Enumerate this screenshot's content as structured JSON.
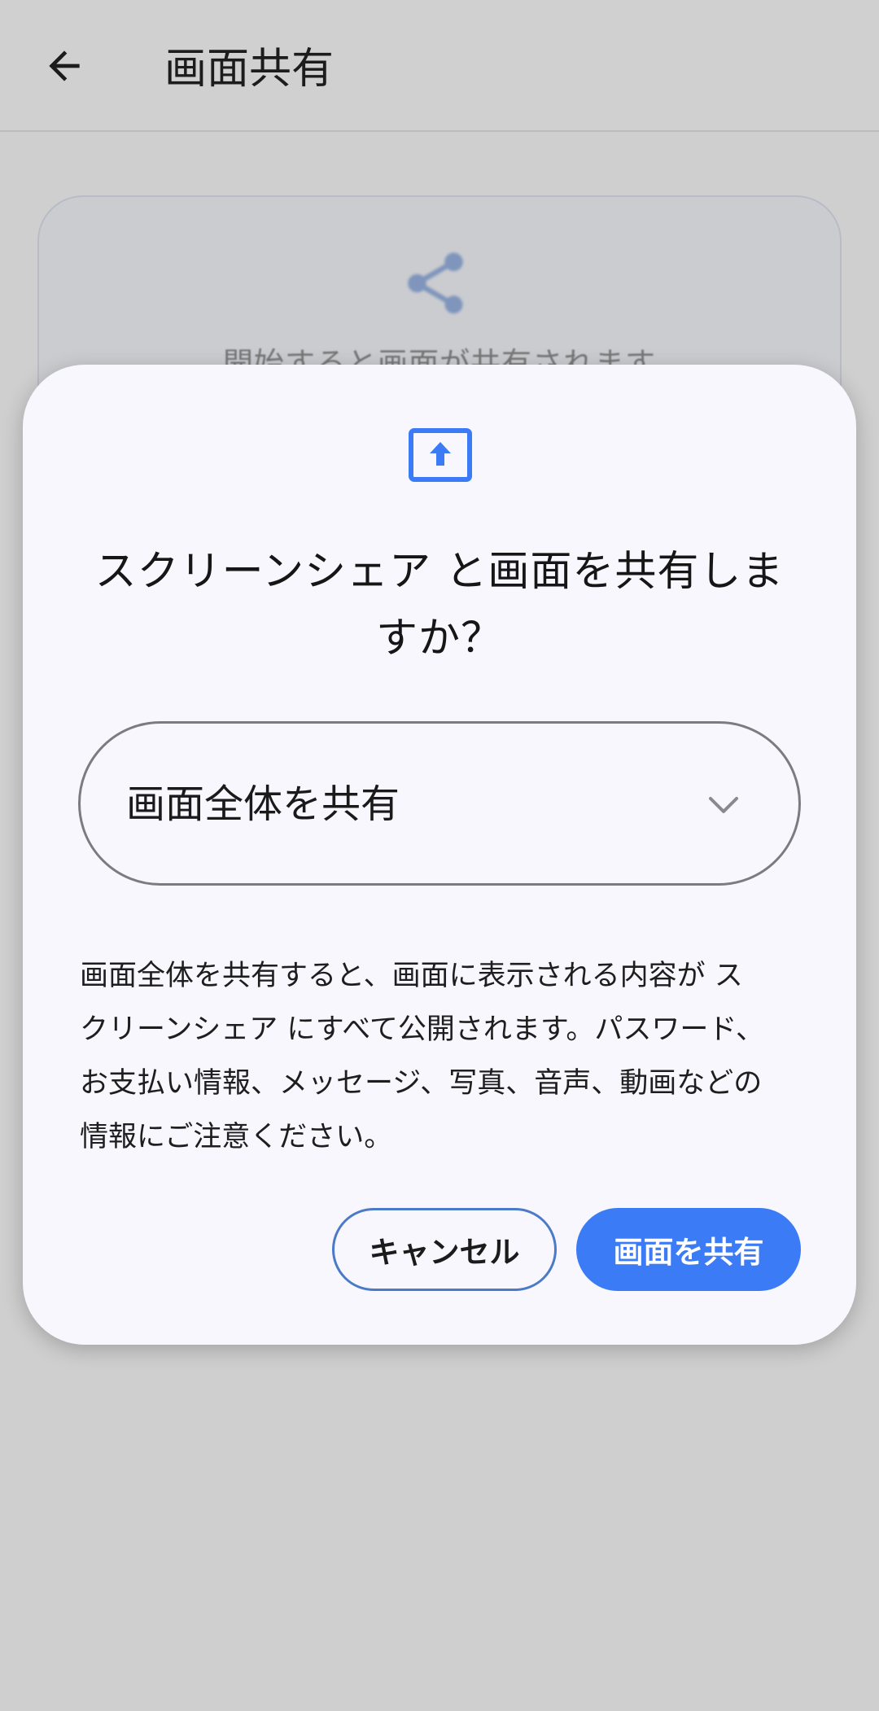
{
  "appbar": {
    "title": "画面共有",
    "back_icon": "arrow-back-icon"
  },
  "background": {
    "share_icon": "share-icon",
    "hint": "開始すると画面が共有されます"
  },
  "dialog": {
    "icon": "screen-share-icon",
    "title_lines": [
      "スクリーンシェア と画面を共有しま",
      "すか？"
    ],
    "select": {
      "value": "画面全体を共有",
      "icon": "chevron-down-icon"
    },
    "warning_lines": [
      "画面全体を共有すると、画面に表示される内容が ス",
      "クリーンシェア にすべて公開されます。パスワード、",
      "お支払い情報、メッセージ、写真、音声、動画などの",
      "情報にご注意ください。"
    ],
    "cancel_label": "キャンセル",
    "share_label": "画面を共有"
  },
  "colors": {
    "accent": "#3b7bf5",
    "scrim": "#cfcfcf",
    "dialog_bg": "#f7f7fd"
  }
}
